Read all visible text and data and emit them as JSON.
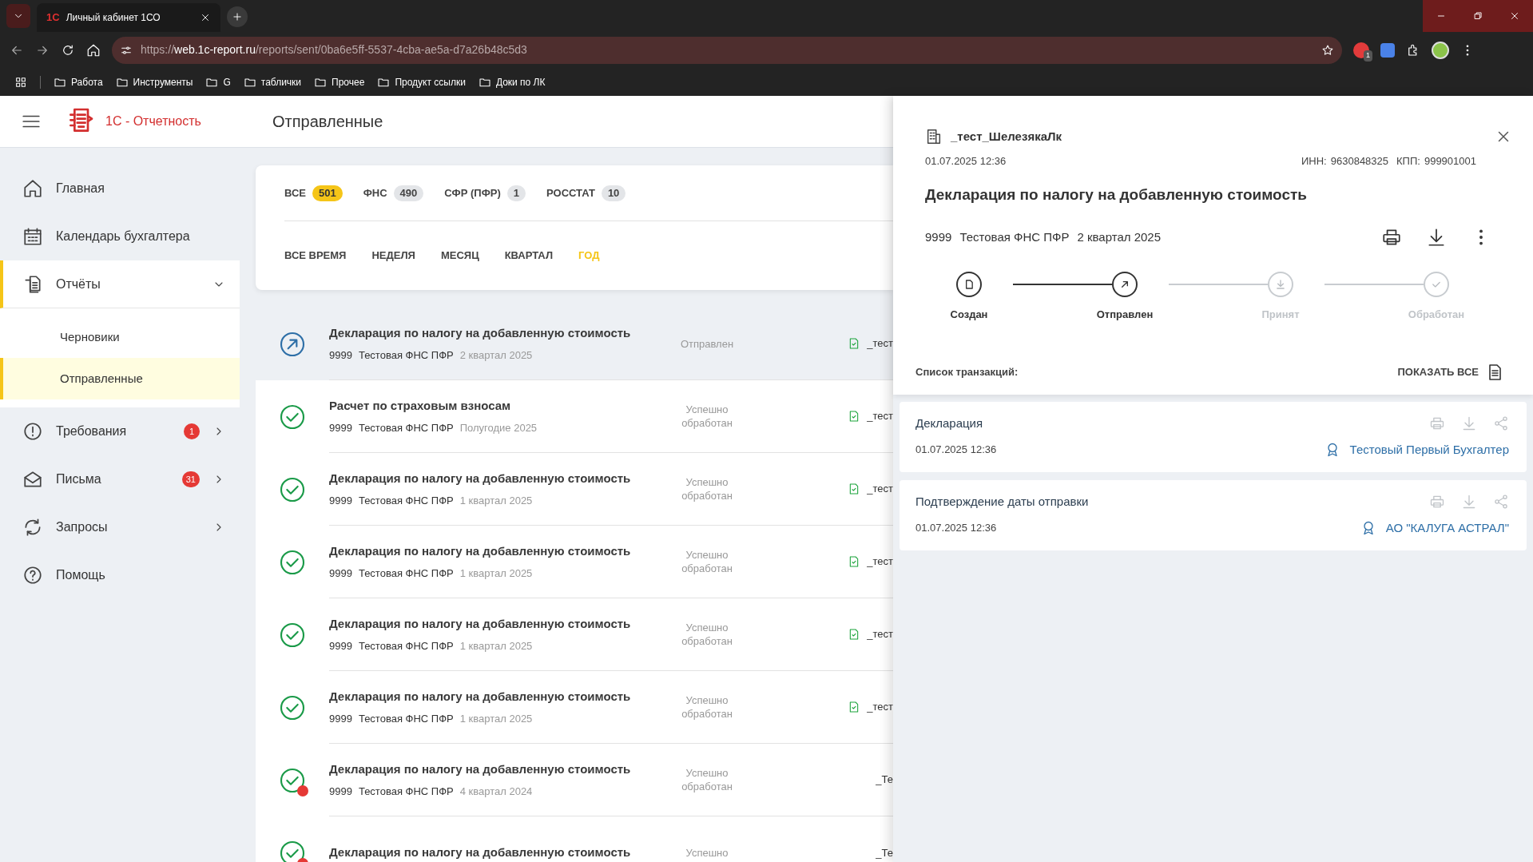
{
  "browser": {
    "tab": {
      "logo": "1С",
      "title": "Личный кабинет 1СО"
    },
    "address": {
      "scheme": "https://",
      "domain": "web.1c-report.ru",
      "path": "/reports/sent/0ba6e5ff-5537-4cba-ae5a-d7a26b48c5d3"
    },
    "extension_badge": "1",
    "bookmarks": [
      "Работа",
      "Инструменты",
      "G",
      "таблички",
      "Прочее",
      "Продукт ссылки",
      "Доки по ЛК"
    ]
  },
  "app": {
    "logo_text": "1С - Отчетность",
    "page_title": "Отправленные"
  },
  "sidebar": {
    "items": [
      {
        "label": "Главная",
        "selected": false
      },
      {
        "label": "Календарь бухгалтера",
        "selected": false
      },
      {
        "label": "Отчёты",
        "selected": false,
        "expanded": true,
        "children": [
          {
            "label": "Черновики",
            "selected": false
          },
          {
            "label": "Отправленные",
            "selected": true
          }
        ]
      },
      {
        "label": "Требования",
        "selected": false,
        "expanded": false,
        "badge": "1"
      },
      {
        "label": "Письма",
        "selected": false,
        "expanded": false,
        "badge": "31"
      },
      {
        "label": "Запросы",
        "selected": false,
        "expanded": false
      },
      {
        "label": "Помощь",
        "selected": false
      }
    ]
  },
  "filters": {
    "recipients": [
      {
        "label": "ВСЕ",
        "count": "501",
        "selected": true
      },
      {
        "label": "ФНС",
        "count": "490",
        "selected": false
      },
      {
        "label": "СФР (ПФР)",
        "count": "1",
        "selected": false
      },
      {
        "label": "РОССТАТ",
        "count": "10",
        "selected": false
      }
    ],
    "periods": [
      {
        "label": "ВСЕ ВРЕМЯ",
        "selected": false
      },
      {
        "label": "НЕДЕЛЯ",
        "selected": false
      },
      {
        "label": "МЕСЯЦ",
        "selected": false
      },
      {
        "label": "КВАРТАЛ",
        "selected": false
      },
      {
        "label": "ГОД",
        "selected": true
      }
    ]
  },
  "reports": [
    {
      "title": "Декларация по налогу на добавленную стоимость",
      "code": "9999",
      "org": "Тестовая ФНС ПФР",
      "period": "2 квартал 2025",
      "status": "Отправлен",
      "kind": "sent",
      "warning": false,
      "doc_icon": true,
      "client": "_тест",
      "selected": true
    },
    {
      "title": "Расчет по страховым взносам",
      "code": "9999",
      "org": "Тестовая ФНС ПФР",
      "period": "Полугодие 2025",
      "status": "Успешно обработан",
      "kind": "success",
      "warning": false,
      "doc_icon": true,
      "client": "_тест",
      "selected": false
    },
    {
      "title": "Декларация по налогу на добавленную стоимость",
      "code": "9999",
      "org": "Тестовая ФНС ПФР",
      "period": "1 квартал 2025",
      "status": "Успешно обработан",
      "kind": "success",
      "warning": false,
      "doc_icon": true,
      "client": "_тест",
      "selected": false
    },
    {
      "title": "Декларация по налогу на добавленную стоимость",
      "code": "9999",
      "org": "Тестовая ФНС ПФР",
      "period": "1 квартал 2025",
      "status": "Успешно обработан",
      "kind": "success",
      "warning": false,
      "doc_icon": true,
      "client": "_тест",
      "selected": false
    },
    {
      "title": "Декларация по налогу на добавленную стоимость",
      "code": "9999",
      "org": "Тестовая ФНС ПФР",
      "period": "1 квартал 2025",
      "status": "Успешно обработан",
      "kind": "success",
      "warning": false,
      "doc_icon": true,
      "client": "_тест",
      "selected": false
    },
    {
      "title": "Декларация по налогу на добавленную стоимость",
      "code": "9999",
      "org": "Тестовая ФНС ПФР",
      "period": "1 квартал 2025",
      "status": "Успешно обработан",
      "kind": "success",
      "warning": false,
      "doc_icon": true,
      "client": "_тест",
      "selected": false
    },
    {
      "title": "Декларация по налогу на добавленную стоимость",
      "code": "9999",
      "org": "Тестовая ФНС ПФР",
      "period": "4 квартал 2024",
      "status": "Успешно обработан",
      "kind": "success",
      "warning": true,
      "doc_icon": false,
      "client": "_Те",
      "selected": false
    },
    {
      "title": "Декларация по налогу на добавленную стоимость",
      "status": "Успешно",
      "kind": "success",
      "warning": true,
      "doc_icon": false,
      "client": "_Те",
      "selected": false
    }
  ],
  "detail": {
    "client": "_тест_ШелезякаЛк",
    "date": "01.07.2025 12:36",
    "inn_label": "ИНН:",
    "inn": "9630848325",
    "kpp_label": "КПП:",
    "kpp": "999901001",
    "title": "Декларация по налогу на добавленную стоимость",
    "code": "9999",
    "org": "Тестовая ФНС ПФР",
    "period": "2 квартал 2025",
    "steps": [
      {
        "label": "Создан",
        "done": true
      },
      {
        "label": "Отправлен",
        "done": true
      },
      {
        "label": "Принят",
        "done": false
      },
      {
        "label": "Обработан",
        "done": false
      }
    ],
    "transactions_label": "Список транзакций:",
    "show_all": "ПОКАЗАТЬ ВСЕ",
    "transactions": [
      {
        "title": "Декларация",
        "date": "01.07.2025 12:36",
        "signer": "Тестовый Первый Бухгалтер"
      },
      {
        "title": "Подтверждение даты отправки",
        "date": "01.07.2025 12:36",
        "signer": "АО \"КАЛУГА АСТРАЛ\""
      }
    ]
  }
}
